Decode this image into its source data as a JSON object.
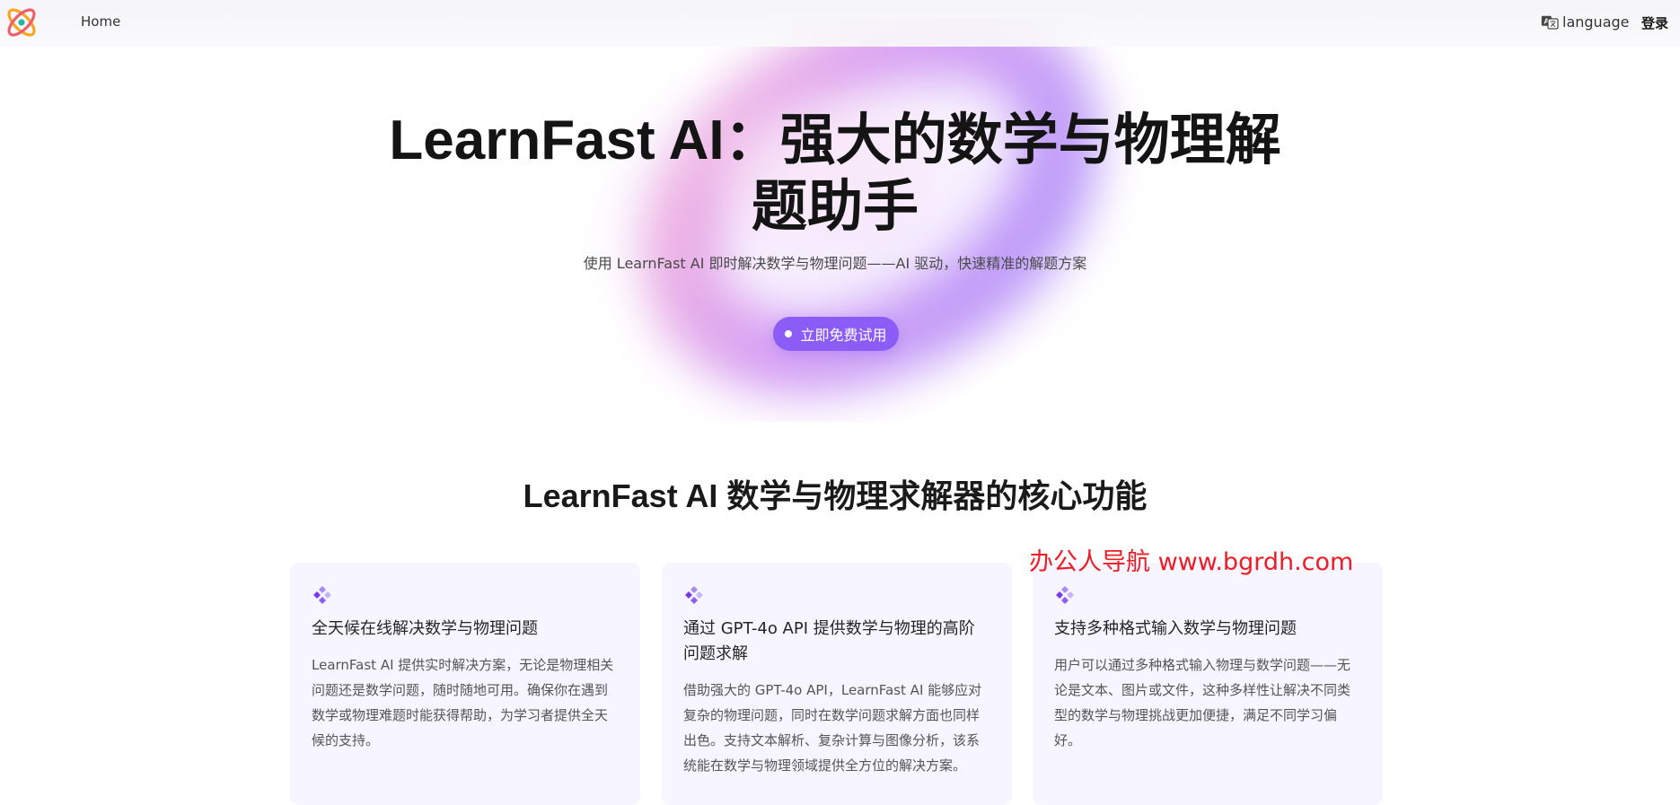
{
  "header": {
    "nav_home": "Home",
    "language_label": "language",
    "login_label": "登录",
    "logo_icon": "atom-logo-icon",
    "language_icon": "translate-icon"
  },
  "hero": {
    "title": "LearnFast AI：强大的数学与物理解题助手",
    "subtitle": "使用 LearnFast AI 即时解决数学与物理问题——AI 驱动，快速精准的解题方案",
    "cta_label": "立即免费试用"
  },
  "features": {
    "title": "LearnFast AI 数学与物理求解器的核心功能",
    "cards": [
      {
        "title": "全天候在线解决数学与物理问题",
        "text": "LearnFast AI 提供实时解决方案，无论是物理相关问题还是数学问题，随时随地可用。确保你在遇到数学或物理难题时能获得帮助，为学习者提供全天候的支持。",
        "icon": "diamond-cluster-icon"
      },
      {
        "title": "通过 GPT-4o API 提供数学与物理的高阶问题求解",
        "text": "借助强大的 GPT-4o API，LearnFast AI 能够应对复杂的物理问题，同时在数学问题求解方面也同样出色。支持文本解析、复杂计算与图像分析，该系统能在数学与物理领域提供全方位的解决方案。",
        "icon": "diamond-cluster-icon"
      },
      {
        "title": "支持多种格式输入数学与物理问题",
        "text": "用户可以通过多种格式输入物理与数学问题——无论是文本、图片或文件，这种多样性让解决不同类型的数学与物理挑战更加便捷，满足不同学习偏好。",
        "icon": "diamond-cluster-icon"
      }
    ]
  },
  "watermark": "办公人导航  www.bgrdh.com",
  "colors": {
    "accent": "#8b5cf6",
    "card_bg": "#f7f5ff",
    "watermark": "#ee1c25"
  }
}
